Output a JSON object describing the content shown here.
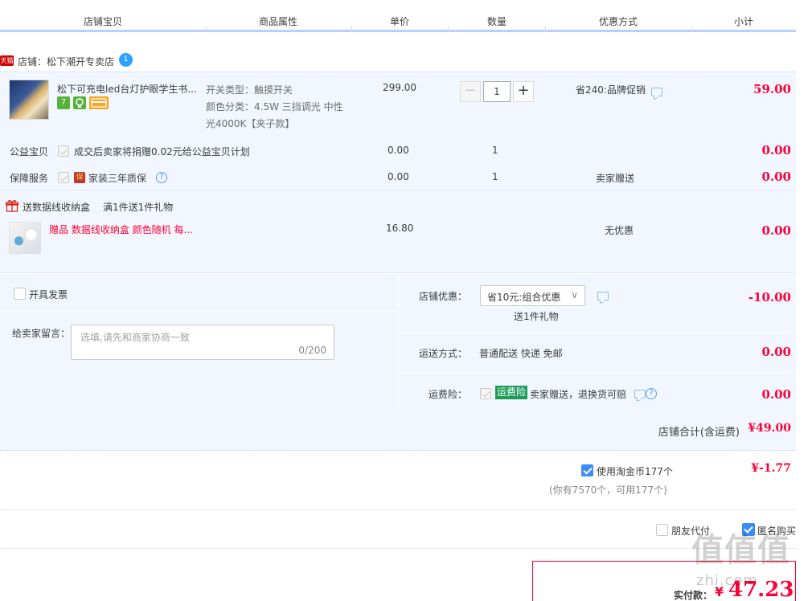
{
  "header": {
    "columns": [
      "店铺宝贝",
      "商品属性",
      "单价",
      "数量",
      "优惠方式",
      "小计"
    ]
  },
  "shop": {
    "badge": "天猫",
    "label": "店铺：松下潮开专卖店",
    "wangwang_badge": "1"
  },
  "item": {
    "title": "松下可充电led台灯护眼学生书...",
    "badges": [
      "7",
      "",
      ""
    ],
    "attrs": [
      "开关类型：触摸开关",
      "颜色分类：4.5W 三挡调光 中性",
      "光4000K【夹子款】"
    ],
    "unit_price": "299.00",
    "quantity": "1",
    "qty_minus": "−",
    "qty_plus": "+",
    "promo": "省240:品牌促销",
    "subtotal": "59.00"
  },
  "services": [
    {
      "name": "公益宝贝",
      "desc": "成交后卖家将捐赠0.02元给公益宝贝计划",
      "price": "0.00",
      "qty": "1",
      "promo": "",
      "subtotal": "0.00"
    },
    {
      "name": "保障服务",
      "badge": "保",
      "desc": "家装三年质保",
      "help": "?",
      "price": "0.00",
      "qty": "1",
      "promo": "卖家赠送",
      "subtotal": "0.00"
    }
  ],
  "gift": {
    "header_title": "送数据线收纳盒",
    "header_rule": "满1件送1件礼物",
    "name": "赠品 数据线收纳盒 颜色随机 每...",
    "price": "16.80",
    "promo": "无优惠",
    "subtotal": "0.00"
  },
  "invoice": {
    "label": "开具发票"
  },
  "message": {
    "label": "给卖家留言：",
    "placeholder": "选填,请先和商家协商一致",
    "counter": "0/200"
  },
  "shop_discount": {
    "label": "店铺优惠：",
    "selected": "省10元:组合优惠",
    "chevron": "∨",
    "sub": "送1件礼物",
    "amount": "-10.00"
  },
  "shipping": {
    "label": "运送方式：",
    "value": "普通配送 快递 免邮",
    "amount": "0.00"
  },
  "freight_insurance": {
    "label": "运费险：",
    "tag": "运费险",
    "desc": "卖家赠送，退换货可赔",
    "help": "?",
    "amount": "0.00"
  },
  "shop_total": {
    "label": "店铺合计(含运费)",
    "amount": "¥49.00"
  },
  "coins": {
    "label": "使用淘金币177个",
    "sub": "(你有7570个，可用177个)",
    "amount": "¥-1.77"
  },
  "options": {
    "friend_pay": "朋友代付",
    "anonymous": "匿名购买"
  },
  "pay": {
    "label": "实付款：",
    "currency": "¥",
    "amount": "47.23"
  },
  "watermark": {
    "text": "值值值",
    "sub": "zhi.com"
  },
  "colors": {
    "accent": "#ff0036",
    "blue_line": "#b2d1ff",
    "panel_bg": "#f2f7ff",
    "checkbox_on": "#3d8bf7"
  }
}
